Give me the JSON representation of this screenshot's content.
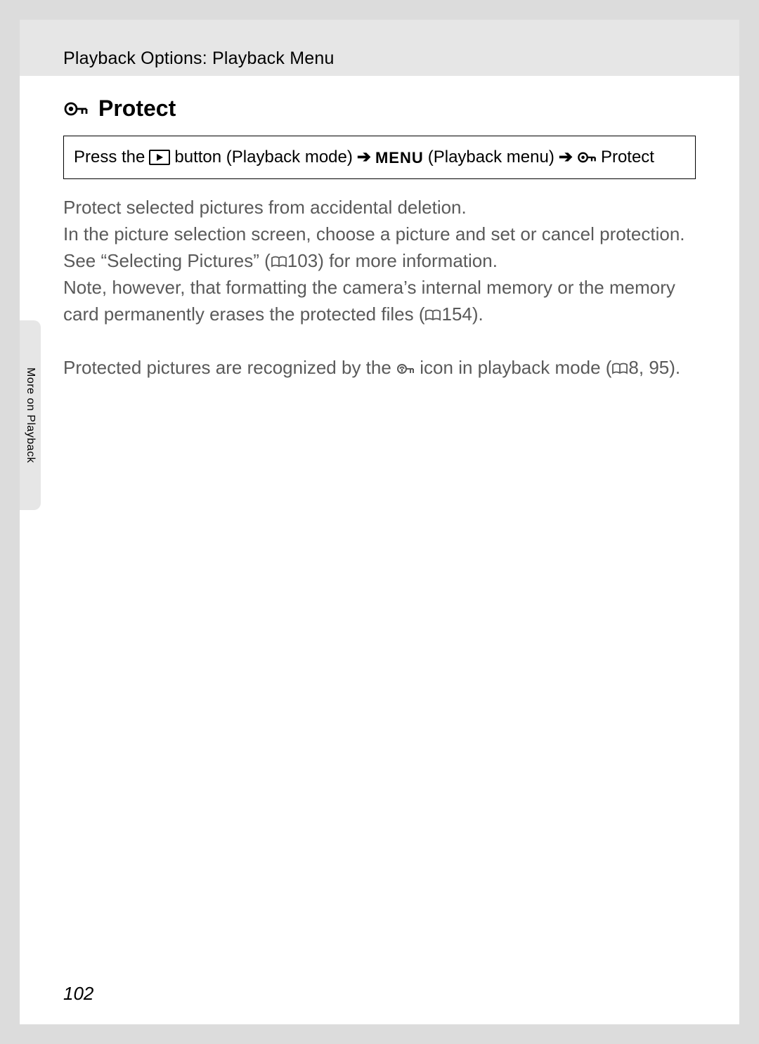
{
  "header": {
    "breadcrumb": "Playback Options: Playback Menu"
  },
  "section": {
    "title": "Protect"
  },
  "navbox": {
    "press_the": "Press the",
    "playback_mode": " button (Playback mode) ",
    "menu_label": "MENU",
    "playback_menu": " (Playback menu) ",
    "protect": " Protect"
  },
  "body": {
    "p1": "Protect selected pictures from accidental deletion.",
    "p2a": "In the picture selection screen, choose a picture and set or cancel protection. See “Selecting Pictures” (",
    "p2_ref": "103",
    "p2b": ") for more information.",
    "p3a": "Note, however, that formatting the camera’s internal memory or the memory card permanently erases the protected files (",
    "p3_ref": "154",
    "p3b": ").",
    "p4a": "Protected pictures are recognized by the ",
    "p4b": " icon in playback mode (",
    "p4_ref": "8, 95",
    "p4c": ")."
  },
  "sidetab": {
    "label": "More on Playback"
  },
  "footer": {
    "page_number": "102"
  }
}
